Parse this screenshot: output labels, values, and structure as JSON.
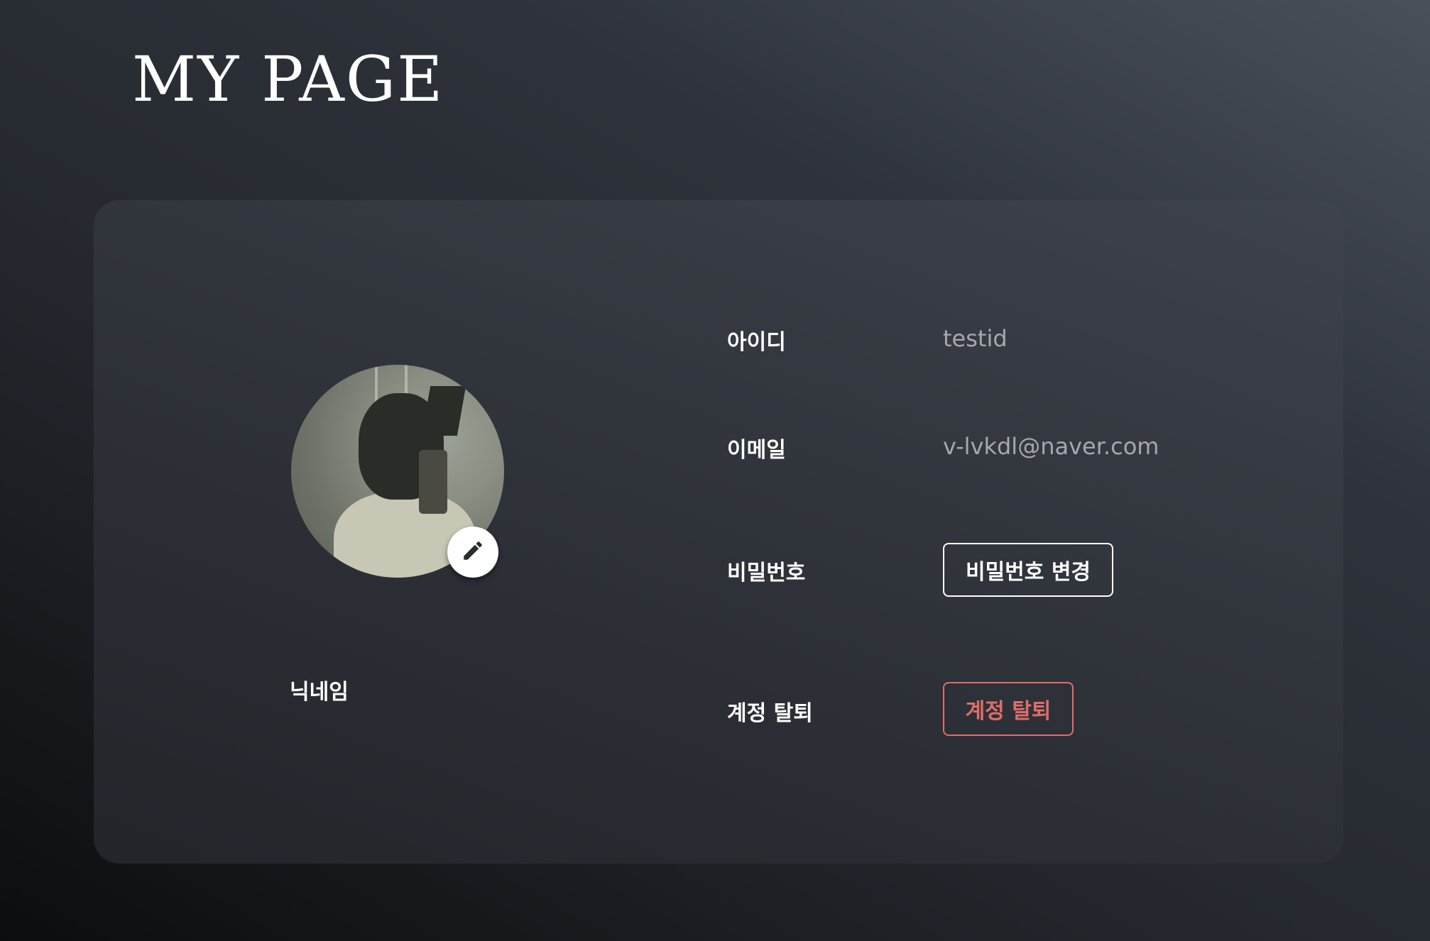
{
  "header": {
    "title": "MY PAGE"
  },
  "profile": {
    "avatar_alt": "profile photo",
    "edit_icon": "pencil-icon",
    "nickname_label": "닉네임"
  },
  "account": {
    "id_label": "아이디",
    "id_value": "testid",
    "email_label": "이메일",
    "email_value": "v-lvkdl@naver.com",
    "password_label": "비밀번호",
    "password_button": "비밀번호 변경",
    "withdraw_label": "계정 탈퇴",
    "withdraw_button": "계정 탈퇴"
  },
  "colors": {
    "danger": "#e06d6b",
    "muted_text": "#a5a8ae"
  }
}
